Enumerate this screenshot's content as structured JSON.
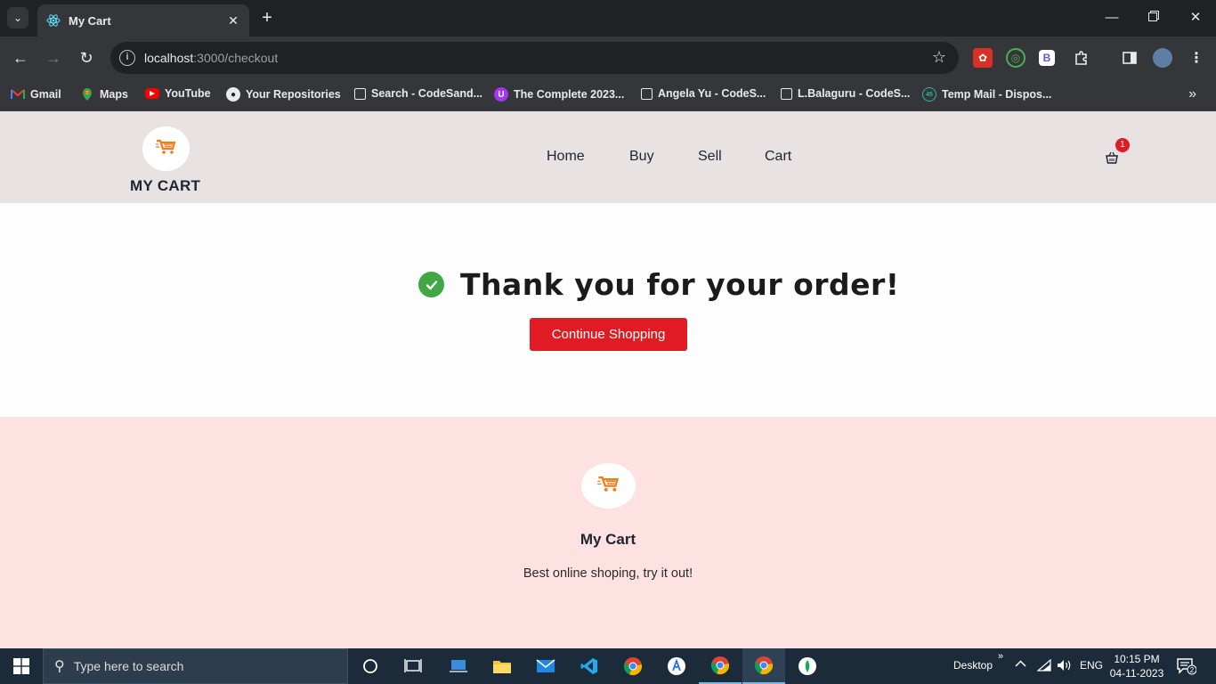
{
  "browser": {
    "tab_title": "My Cart",
    "url_host": "localhost",
    "url_rest": ":3000/checkout",
    "bookmarks": [
      {
        "label": "Gmail",
        "icon": "gmail-icon"
      },
      {
        "label": "Maps",
        "icon": "maps-icon"
      },
      {
        "label": "YouTube",
        "icon": "youtube-icon"
      },
      {
        "label": "Your Repositories",
        "icon": "github-icon"
      },
      {
        "label": "Search - CodeSand...",
        "icon": "page-icon"
      },
      {
        "label": "The Complete 2023...",
        "icon": "udemy-icon"
      },
      {
        "label": "Angela Yu - CodeS...",
        "icon": "page-icon"
      },
      {
        "label": "L.Balaguru - CodeS...",
        "icon": "page-icon"
      },
      {
        "label": "Temp Mail - Dispos...",
        "icon": "tempmail-icon"
      }
    ]
  },
  "site": {
    "brand": "MY CART",
    "nav": [
      {
        "label": "Home"
      },
      {
        "label": "Buy"
      },
      {
        "label": "Sell"
      },
      {
        "label": "Cart"
      }
    ],
    "cart_count": "1"
  },
  "main": {
    "message": "Thank you for your order!",
    "button_label": "Continue Shopping"
  },
  "footer": {
    "title": "My Cart",
    "tagline": "Best online shoping, try it out!"
  },
  "taskbar": {
    "search_placeholder": "Type here to search",
    "desktop_label": "Desktop",
    "lang": "ENG",
    "time": "10:15 PM",
    "date": "04-11-2023",
    "notification_count": "2"
  },
  "colors": {
    "accent_red": "#e01b24",
    "success_green": "#3fa845",
    "header_bg": "#e8e2e2",
    "footer_bg": "#fee1e1",
    "logo_orange": "#f07c1b"
  }
}
